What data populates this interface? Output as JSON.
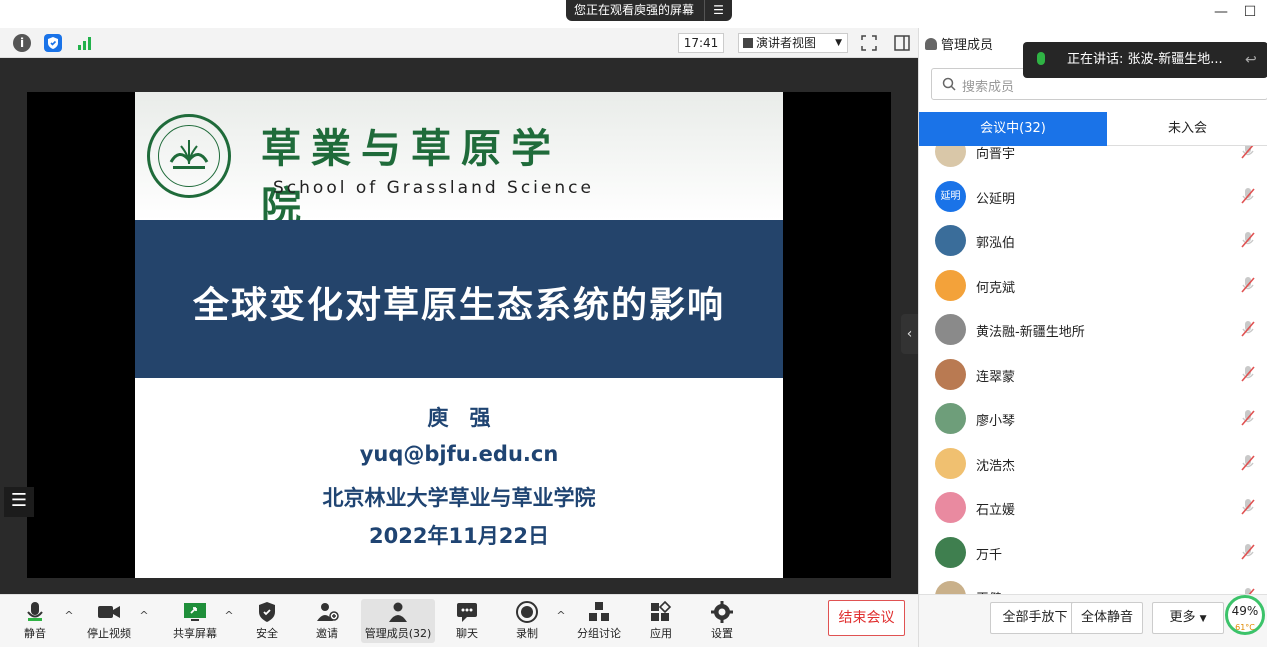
{
  "window": {
    "viewing_banner": "您正在观看庾强的屏幕",
    "menu_glyph": "☰",
    "minimize": "—",
    "maximize": "☐"
  },
  "topbar": {
    "time": "17:41",
    "view_mode": "演讲者视图",
    "info_icon": "info-icon",
    "shield_icon": "shield-icon",
    "signal_icon": "signal-icon"
  },
  "slide": {
    "school_cn": "草業与草原学院",
    "school_en": "School of Grassland Science",
    "title": "全球变化对草原生态系统的影响",
    "author": "庾　强",
    "email": "yuq@bjfu.edu.cn",
    "org": "北京林业大学草业与草业学院",
    "date": "2022年11月22日",
    "colors": {
      "band": "#24446b",
      "school_green": "#1f6b3a",
      "text_blue": "#1f4472"
    }
  },
  "toolbar": {
    "mute": "静音",
    "stop_video": "停止视频",
    "share_screen": "共享屏幕",
    "security": "安全",
    "invite": "邀请",
    "manage_members": "管理成员(32)",
    "chat": "聊天",
    "record": "录制",
    "breakout": "分组讨论",
    "apps": "应用",
    "settings": "设置",
    "end_meeting": "结束会议"
  },
  "panel": {
    "title": "管理成员",
    "speaking": "正在讲话: 张波-新疆生地...",
    "search_placeholder": "搜索成员",
    "tab_in": "会议中(32)",
    "tab_out": "未入会",
    "members": [
      {
        "name": "向晋宇",
        "avatar_color": "#d9c7a8",
        "initials": ""
      },
      {
        "name": "公延明",
        "avatar_color": "#1a73e8",
        "initials": "延明"
      },
      {
        "name": "郭泓伯",
        "avatar_color": "#3a6d9a",
        "initials": ""
      },
      {
        "name": "何克斌",
        "avatar_color": "#f3a23a",
        "initials": ""
      },
      {
        "name": "黄法融-新疆生地所",
        "avatar_color": "#8a8a8a",
        "initials": ""
      },
      {
        "name": "连翠蒙",
        "avatar_color": "#b97a52",
        "initials": ""
      },
      {
        "name": "廖小琴",
        "avatar_color": "#6e9e7a",
        "initials": ""
      },
      {
        "name": "沈浩杰",
        "avatar_color": "#f0c070",
        "initials": ""
      },
      {
        "name": "石立媛",
        "avatar_color": "#e98aa0",
        "initials": ""
      },
      {
        "name": "万千",
        "avatar_color": "#3f7f4f",
        "initials": ""
      },
      {
        "name": "王健",
        "avatar_color": "#c9b08a",
        "initials": ""
      }
    ],
    "footer": {
      "lower_all_hands": "全部手放下",
      "mute_all": "全体静音",
      "more": "更多",
      "cpu_percent": "49%",
      "cpu_temp": "61°C"
    }
  }
}
